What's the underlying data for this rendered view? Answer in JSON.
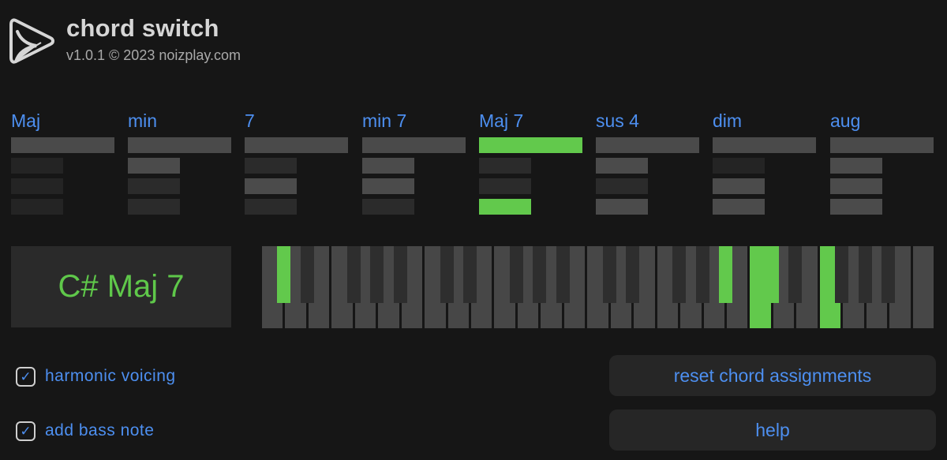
{
  "header": {
    "title": "chord switch",
    "version": "v1.0.1 © 2023 noizplay.com",
    "logo_icon": "noizplay-play-logo-icon"
  },
  "colors": {
    "background": "#161616",
    "accent_blue": "#4d8ff0",
    "active_green": "#62c94c",
    "key_white": "#474747",
    "key_black": "#2e2e2e"
  },
  "chords": [
    {
      "label": "Maj",
      "active": false,
      "steps": [
        "off",
        "off",
        "off"
      ]
    },
    {
      "label": "min",
      "active": false,
      "steps": [
        "on",
        "mid",
        "mid"
      ]
    },
    {
      "label": "7",
      "active": false,
      "steps": [
        "mid",
        "on",
        "mid"
      ]
    },
    {
      "label": "min 7",
      "active": false,
      "steps": [
        "on",
        "on",
        "mid"
      ]
    },
    {
      "label": "Maj 7",
      "active": true,
      "steps": [
        "mid",
        "mid",
        "green"
      ]
    },
    {
      "label": "sus 4",
      "active": false,
      "steps": [
        "on",
        "mid",
        "on"
      ]
    },
    {
      "label": "dim",
      "active": false,
      "steps": [
        "off",
        "on",
        "on"
      ]
    },
    {
      "label": "aug",
      "active": false,
      "steps": [
        "on",
        "on",
        "on"
      ]
    }
  ],
  "current_chord": "C# Maj 7",
  "keyboard": {
    "white_keys_count": 29,
    "black_keys_pattern": "C# D# F# G# A#",
    "active_notes": [
      "C#",
      "G#",
      "C",
      "D#",
      "F"
    ]
  },
  "options": {
    "harmonic_voicing": {
      "label": "harmonic voicing",
      "checked": true,
      "icon": "checkmark-icon"
    },
    "add_bass_note": {
      "label": "add bass note",
      "checked": true,
      "icon": "checkmark-icon"
    }
  },
  "buttons": {
    "reset": "reset chord assignments",
    "help": "help"
  }
}
